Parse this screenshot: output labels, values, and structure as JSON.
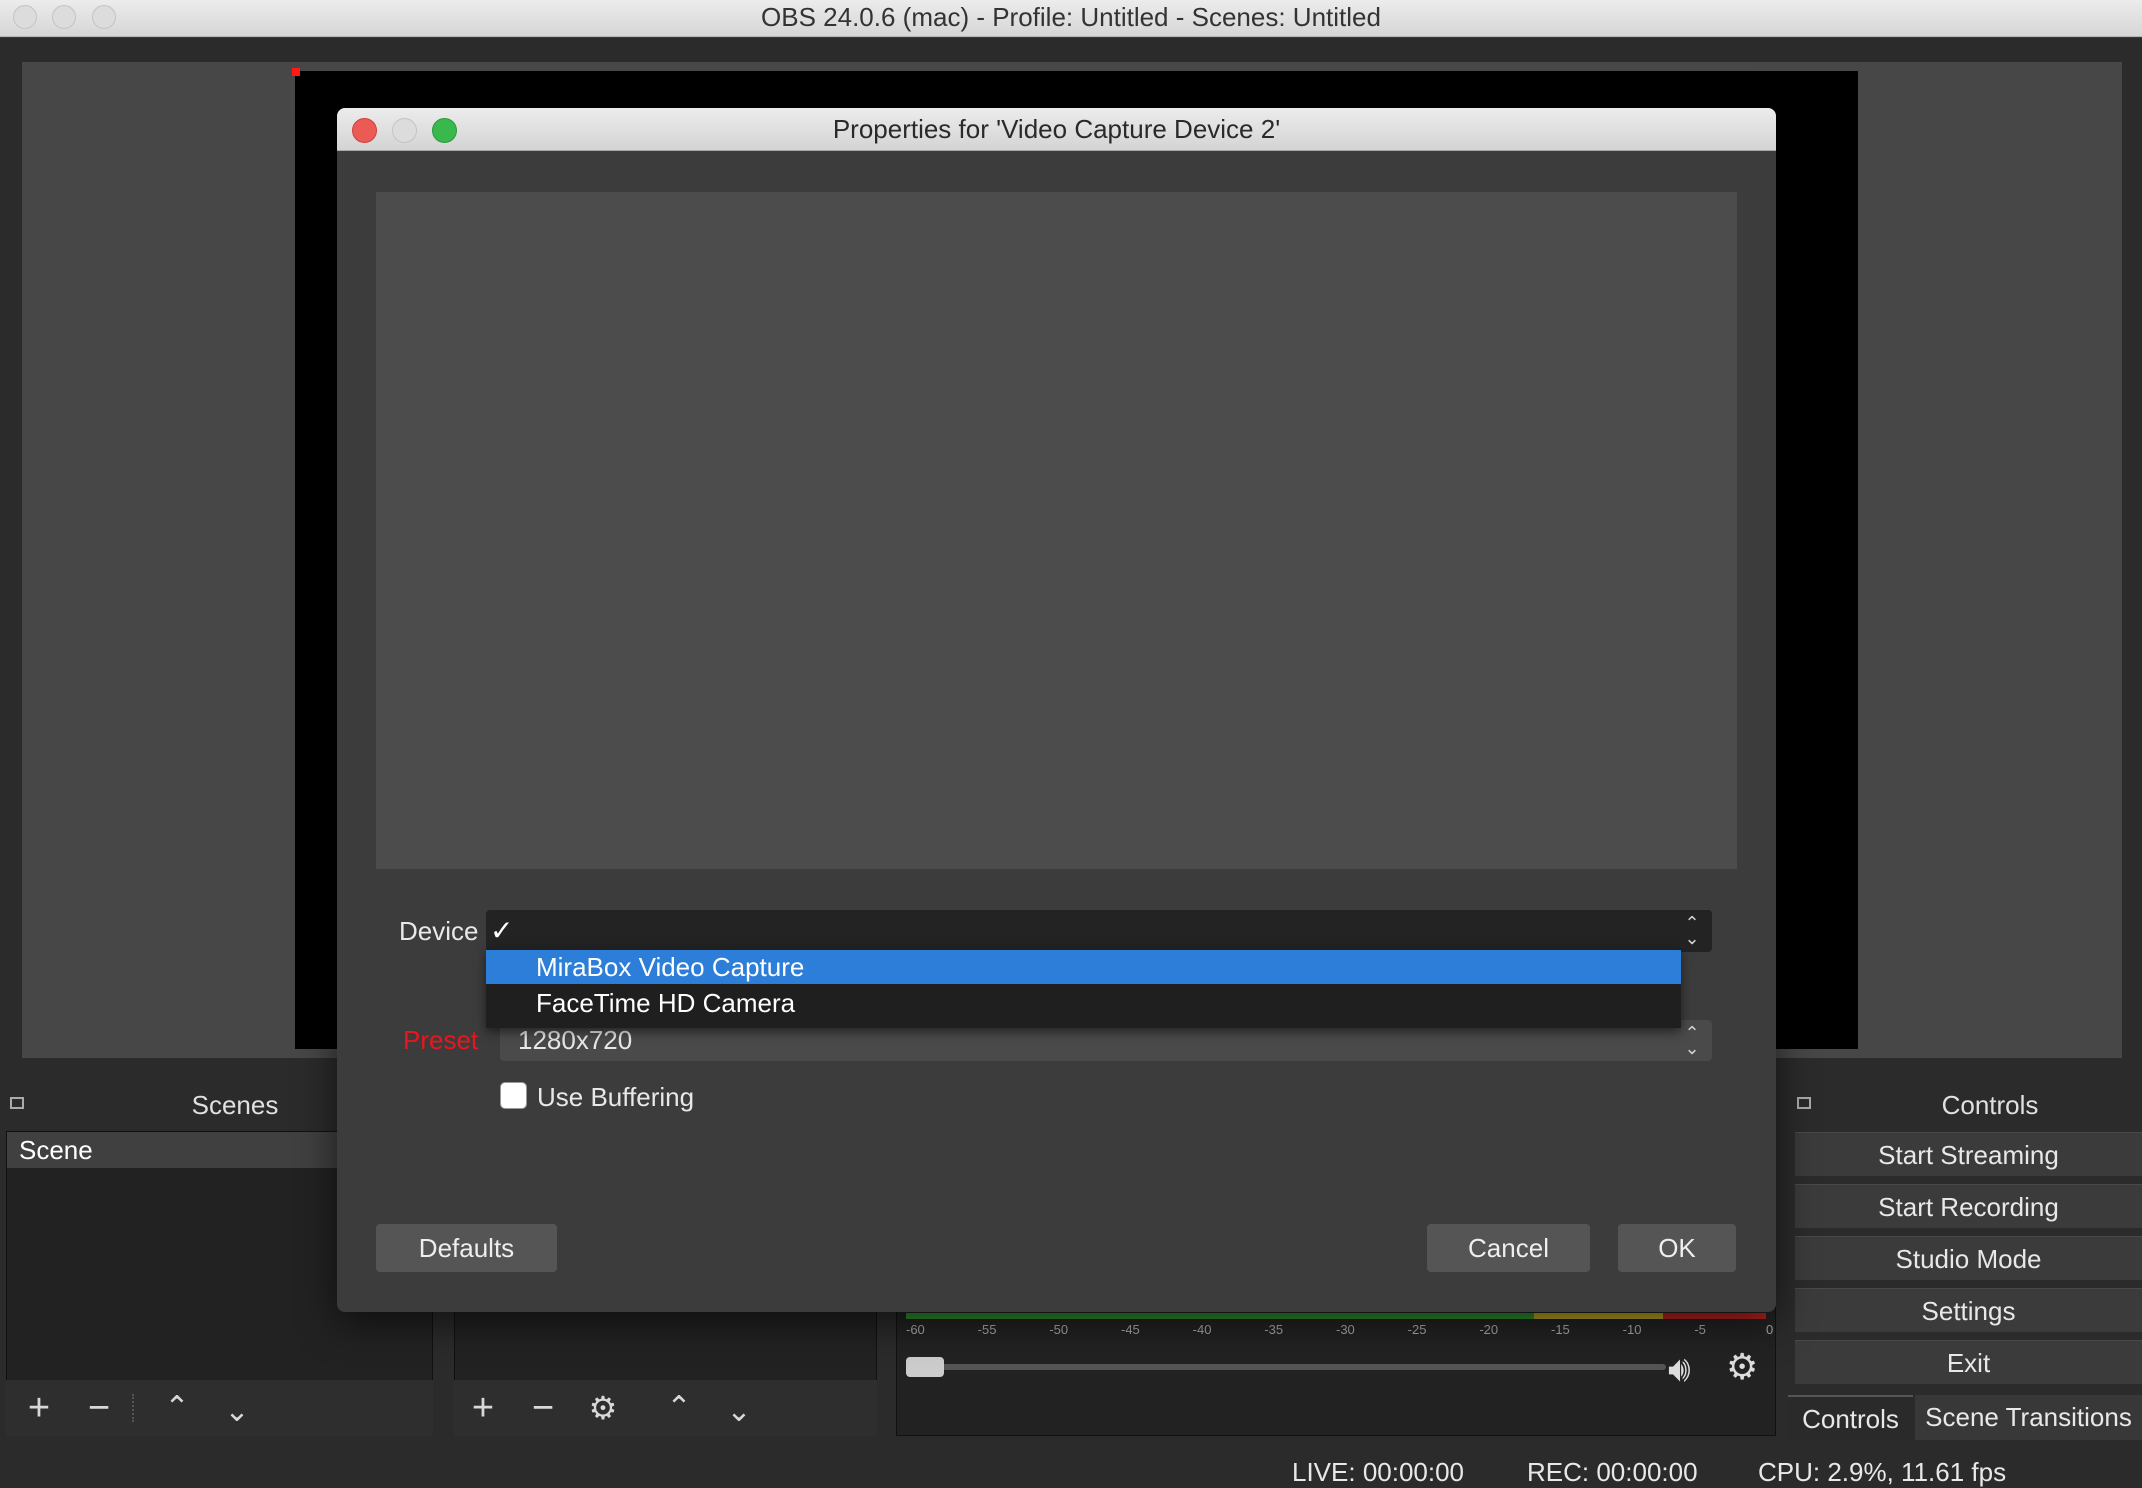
{
  "window": {
    "title": "OBS 24.0.6 (mac) - Profile: Untitled - Scenes: Untitled"
  },
  "scenes": {
    "title": "Scenes",
    "items": [
      "Scene"
    ]
  },
  "controls": {
    "title": "Controls",
    "buttons": [
      "Start Streaming",
      "Start Recording",
      "Studio Mode",
      "Settings",
      "Exit"
    ],
    "tabs": [
      "Controls",
      "Scene Transitions"
    ]
  },
  "mixer": {
    "scale": [
      "-60",
      "-55",
      "-50",
      "-45",
      "-40",
      "-35",
      "-30",
      "-25",
      "-20",
      "-15",
      "-10",
      "-5",
      "0"
    ]
  },
  "status": {
    "live": "LIVE: 00:00:00",
    "rec": "REC: 00:00:00",
    "cpu": "CPU: 2.9%, 11.61 fps"
  },
  "dialog": {
    "title": "Properties for 'Video Capture Device 2'",
    "device_label": "Device",
    "device_check": "✓",
    "device_options": [
      "MiraBox Video Capture",
      "FaceTime HD Camera"
    ],
    "device_highlighted": "MiraBox Video Capture",
    "preset_label": "Preset",
    "preset_value": "1280x720",
    "buffering_label": "Use Buffering",
    "buffering_checked": false,
    "defaults_label": "Defaults",
    "cancel_label": "Cancel",
    "ok_label": "OK"
  },
  "colors": {
    "highlight": "#2d7ed8",
    "preset_label": "#e8171d",
    "close": "#ec5a56",
    "zoom": "#39b94b"
  }
}
